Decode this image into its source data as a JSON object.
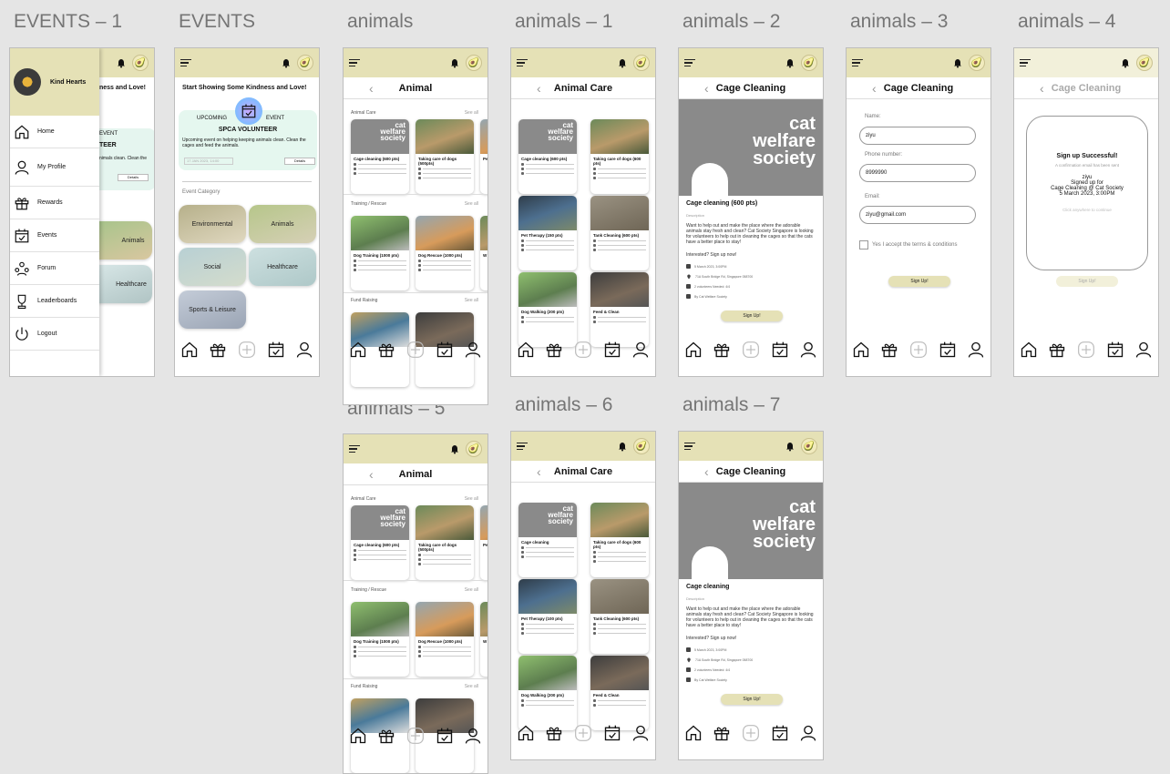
{
  "labels": {
    "events1": "EVENTS – 1",
    "events": "EVENTS",
    "animals": "animals",
    "animals1": "animals – 1",
    "animals2": "animals – 2",
    "animals3": "animals – 3",
    "animals4": "animals – 4",
    "animals5": "animals – 5",
    "animals6": "animals – 6",
    "animals7": "animals – 7"
  },
  "colors": {
    "topbar": "#e5e1b6",
    "canvas": "#e5e5e5"
  },
  "drawer": {
    "brand": "Kind Hearts",
    "items": [
      "Home",
      "My Profile",
      "Rewards",
      "Events",
      "Forum",
      "Leaderboards",
      "Logout"
    ],
    "behind_heading": "ness and Love!",
    "behind_event": "EVENT",
    "behind_title": "TEER",
    "behind_text": "nimals clean. Clean the",
    "behind_details": "Details",
    "behind_animals": "Animals",
    "behind_healthcare": "Healthcare"
  },
  "events": {
    "heading": "Start Showing Some Kindness and Love!",
    "upcoming": "UPCOMING",
    "event": "EVENT",
    "title": "SPCA VOLUNTEER",
    "desc": "Upcoming event on helping keeping animals clean. Clean the cages and feed the animals.",
    "date": "17 JAN 2023, 14:00",
    "details": "Details",
    "category_label": "Event Category",
    "categories": [
      "Environmental",
      "Animals",
      "Social",
      "Healthcare",
      "Sports & Leisure"
    ]
  },
  "animal_list": {
    "title": "Animal",
    "see_all": "See all",
    "sections": [
      "Animal Care",
      "Training / Rescue",
      "Fund Raising"
    ],
    "care_cards": [
      "Cage cleaning (600 pts)",
      "Taking care of dogs (500pts)",
      "Pe"
    ],
    "training_cards": [
      "Dog Training (1000 pts)",
      "Dog Rescue (1000 pts)",
      "W"
    ]
  },
  "animal_care": {
    "title": "Animal Care",
    "cards": [
      "Cage cleaning (600 pts)",
      "Taking care of dogs (600 pts)",
      "Pet Therapy (150 pts)",
      "Tank Cleaning (600 pts)",
      "Dog Walking (200 pts)",
      "Feed & Clean"
    ],
    "cards_v6": [
      "Cage cleaning",
      "Taking care of dogs (600 pts)",
      "Pet Therapy (100 pts)",
      "Tank Cleaning (600 pts)",
      "Dog Walking (200 pts)",
      "Feed & Clean"
    ]
  },
  "cage": {
    "title": "Cage Cleaning",
    "logo_lines": [
      "cat",
      "welfare",
      "society"
    ],
    "heading": "Cage cleaning (600 pts)",
    "heading7": "Cage cleaning",
    "desc_label": "Description",
    "body": "Want to help out and make the place where the adorable animals stay fresh and clean? Cat Society Singapore is looking for volunteers to help out in cleaning the cages so that the cats have a better place to stay!",
    "cta": "Interested? Sign up now!",
    "info": [
      "5 March 2023, 3:00PM",
      "71A South Bridge Rd, Singapore 058700",
      "2 volunteers Needed: 4/4",
      "By Cat Welfare Society"
    ],
    "signup": "Sign Up!"
  },
  "form": {
    "name_label": "Name:",
    "name_value": "ziyu",
    "phone_label": "Phone number:",
    "phone_value": "8999990",
    "email_label": "Email:",
    "email_value": "ziyu@gmail.com",
    "terms": "Yes I accept the terms & conditions",
    "signup": "Sign Up!"
  },
  "success": {
    "title": "Sign up Successful!",
    "sub": "A confirmation email has been sent",
    "name": "ziyu",
    "line1": "Signed up for",
    "line2": "Cage Cleaning @ Cat Society",
    "line3": "5 March 2023, 3:00PM",
    "hint": "Click anywhere to continue",
    "signup": "Sign Up!"
  }
}
